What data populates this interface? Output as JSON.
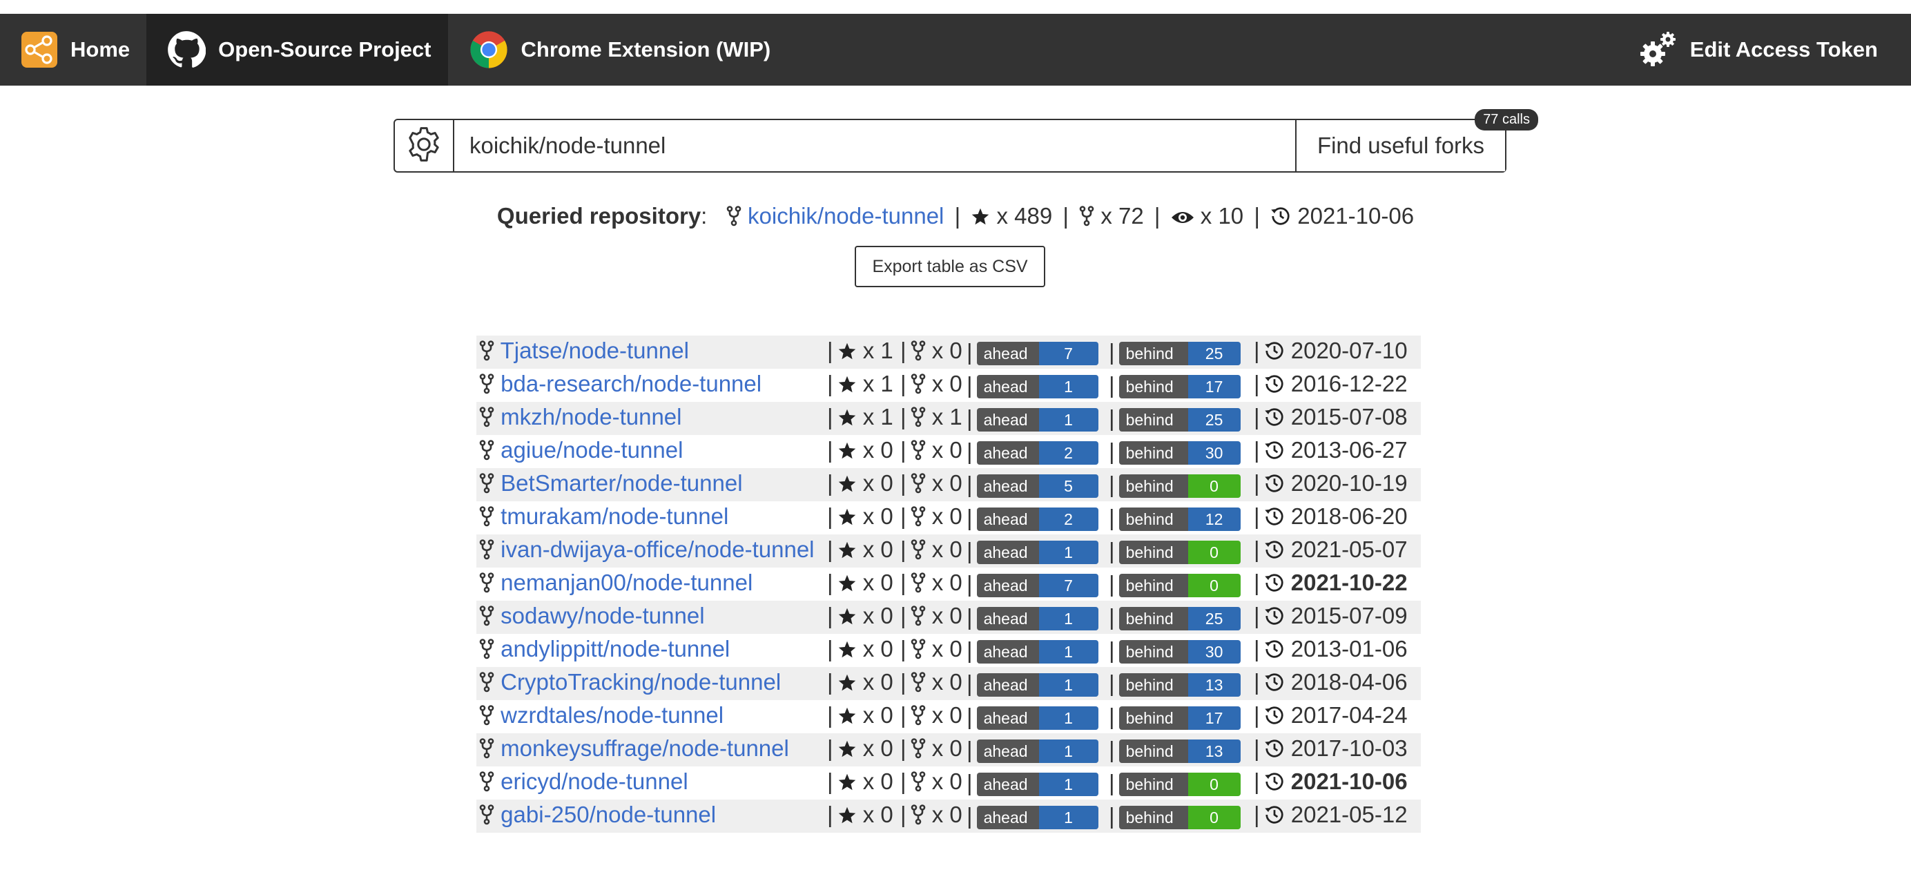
{
  "nav": {
    "home": "Home",
    "project": "Open-Source Project",
    "extension": "Chrome Extension (WIP)",
    "edit_token": "Edit Access Token"
  },
  "search": {
    "value": "koichik/node-tunnel",
    "button": "Find useful forks",
    "calls": "77 calls"
  },
  "queried": {
    "label": "Queried repository",
    "repo": "koichik/node-tunnel",
    "stars": "x 489",
    "forks": "x 72",
    "watchers": "x 10",
    "date": "2021-10-06"
  },
  "export_label": "Export table as CSV",
  "badge_labels": {
    "ahead": "ahead",
    "behind": "behind"
  },
  "colors": {
    "link": "#3c6ec9",
    "badge_blue": "#2f6bb3",
    "badge_green": "#44b01f",
    "nav_bg": "#333333"
  },
  "forks": [
    {
      "name": "Tjatse/node-tunnel",
      "stars": "x 1",
      "forks": "x 0",
      "ahead": "7",
      "behind": "25",
      "date": "2020-07-10",
      "recent": false
    },
    {
      "name": "bda-research/node-tunnel",
      "stars": "x 1",
      "forks": "x 0",
      "ahead": "1",
      "behind": "17",
      "date": "2016-12-22",
      "recent": false
    },
    {
      "name": "mkzh/node-tunnel",
      "stars": "x 1",
      "forks": "x 1",
      "ahead": "1",
      "behind": "25",
      "date": "2015-07-08",
      "recent": false
    },
    {
      "name": "agiue/node-tunnel",
      "stars": "x 0",
      "forks": "x 0",
      "ahead": "2",
      "behind": "30",
      "date": "2013-06-27",
      "recent": false
    },
    {
      "name": "BetSmarter/node-tunnel",
      "stars": "x 0",
      "forks": "x 0",
      "ahead": "5",
      "behind": "0",
      "date": "2020-10-19",
      "recent": false
    },
    {
      "name": "tmurakam/node-tunnel",
      "stars": "x 0",
      "forks": "x 0",
      "ahead": "2",
      "behind": "12",
      "date": "2018-06-20",
      "recent": false
    },
    {
      "name": "ivan-dwijaya-office/node-tunnel",
      "stars": "x 0",
      "forks": "x 0",
      "ahead": "1",
      "behind": "0",
      "date": "2021-05-07",
      "recent": false
    },
    {
      "name": "nemanjan00/node-tunnel",
      "stars": "x 0",
      "forks": "x 0",
      "ahead": "7",
      "behind": "0",
      "date": "2021-10-22",
      "recent": true
    },
    {
      "name": "sodawy/node-tunnel",
      "stars": "x 0",
      "forks": "x 0",
      "ahead": "1",
      "behind": "25",
      "date": "2015-07-09",
      "recent": false
    },
    {
      "name": "andylippitt/node-tunnel",
      "stars": "x 0",
      "forks": "x 0",
      "ahead": "1",
      "behind": "30",
      "date": "2013-01-06",
      "recent": false
    },
    {
      "name": "CryptoTracking/node-tunnel",
      "stars": "x 0",
      "forks": "x 0",
      "ahead": "1",
      "behind": "13",
      "date": "2018-04-06",
      "recent": false
    },
    {
      "name": "wzrdtales/node-tunnel",
      "stars": "x 0",
      "forks": "x 0",
      "ahead": "1",
      "behind": "17",
      "date": "2017-04-24",
      "recent": false
    },
    {
      "name": "monkeysuffrage/node-tunnel",
      "stars": "x 0",
      "forks": "x 0",
      "ahead": "1",
      "behind": "13",
      "date": "2017-10-03",
      "recent": false
    },
    {
      "name": "ericyd/node-tunnel",
      "stars": "x 0",
      "forks": "x 0",
      "ahead": "1",
      "behind": "0",
      "date": "2021-10-06",
      "recent": true
    },
    {
      "name": "gabi-250/node-tunnel",
      "stars": "x 0",
      "forks": "x 0",
      "ahead": "1",
      "behind": "0",
      "date": "2021-05-12",
      "recent": false
    }
  ]
}
